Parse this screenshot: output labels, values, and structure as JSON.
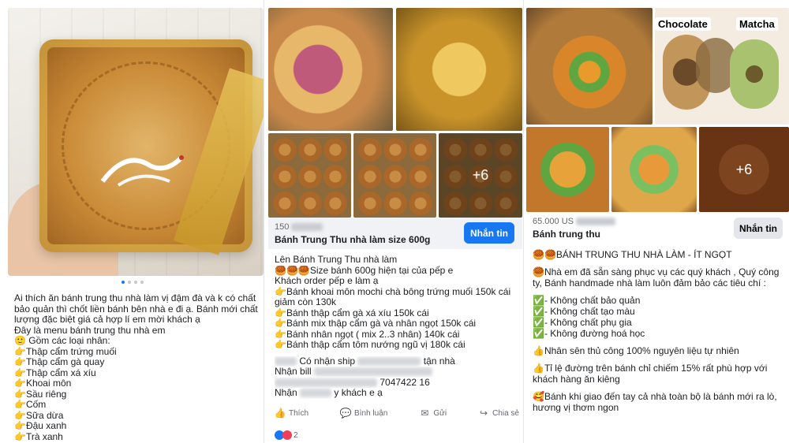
{
  "panel1": {
    "post_lines": [
      "Ai thích ăn bánh trung thu nhà làm vị đậm đà và k có chất",
      "bảo quản thì chốt liền bánh bên nhà e đi ạ. Bánh mới chất",
      "lượng đặc biệt giá cả hợp lí em mời khách ạ",
      "Đây là menu bánh trung thu nhà em",
      "🙂 Gồm các loại nhân:",
      "👉Thập cẩm trứng muối",
      "👉Thập cẩm gà quay",
      "👉Thập cẩm xá xíu",
      "👉Khoai môn",
      "👉Sầu riêng",
      "👉Cốm",
      "👉Sữa dừa",
      "👉Đậu xanh",
      "👉Trà xanh"
    ]
  },
  "panel2": {
    "more_count": "+6",
    "price_prefix": "150",
    "listing_title": "Bánh Trung Thu nhà làm size 600g",
    "message_button": "Nhắn tin",
    "post_lines": [
      "Lên Bánh Trung Thu nhà làm",
      "🥮🥮🥮Size bánh 600g hiện tại của pếp e",
      "Khách order pếp e làm ạ",
      "👉Bánh khoai môn mochi chà bông trứng muối 150k cái",
      "giảm còn 130k",
      "👉Bánh thập cẩm gà xá xíu 150k cái",
      "👉Bánh mix thập cẩm gà và nhân ngọt 150k cái",
      "👉Bánh nhân ngọt ( mix 2..3 nhân) 140k cái",
      "👉Bánh thập cẩm tôm nướng ngũ vị 180k cái"
    ],
    "blur_line1": "Có nhận ship",
    "blur_line1_suffix": "tận nhà",
    "blur_line2": "Nhận bill",
    "blur_line3_end": "7047422 16",
    "blur_line4": "Nhận",
    "blur_line4_suffix": "y khách e ạ",
    "actions": {
      "like": "Thích",
      "comment": "Bình luận",
      "send": "Gửi",
      "share": "Chia sẻ"
    },
    "reaction_count": "2"
  },
  "panel3": {
    "label_chocolate": "Chocolate",
    "label_matcha": "Matcha",
    "more_count": "+6",
    "price": "65.000 US",
    "listing_title": "Bánh trung thu",
    "message_button": "Nhắn tin",
    "post_lines": [
      "🥮🥮BÁNH TRUNG THU NHÀ LÀM  - ÍT NGỌT",
      "",
      "🥮Nhà em đã sẵn sàng phục vụ các quý khách , Quý công",
      "ty, Bánh handmade nhà làm luôn đảm bảo các tiêu chí :",
      "",
      "✅- Không chất bảo quản",
      "✅- Không chất tạo màu",
      "✅- Không chất phụ gia",
      "✅- Không đường hoá học",
      "",
      "👍Nhân sên thủ công 100% nguyên liệu tự nhiên",
      "",
      "👍Tỉ lệ đường trên bánh chỉ chiếm 15% rất phù hợp với",
      "khách hàng ăn kiêng",
      "",
      "🥰Bánh khi giao đến tay cả nhà toàn bộ là bánh mới ra lò,",
      "hương vị thơm ngon"
    ]
  }
}
